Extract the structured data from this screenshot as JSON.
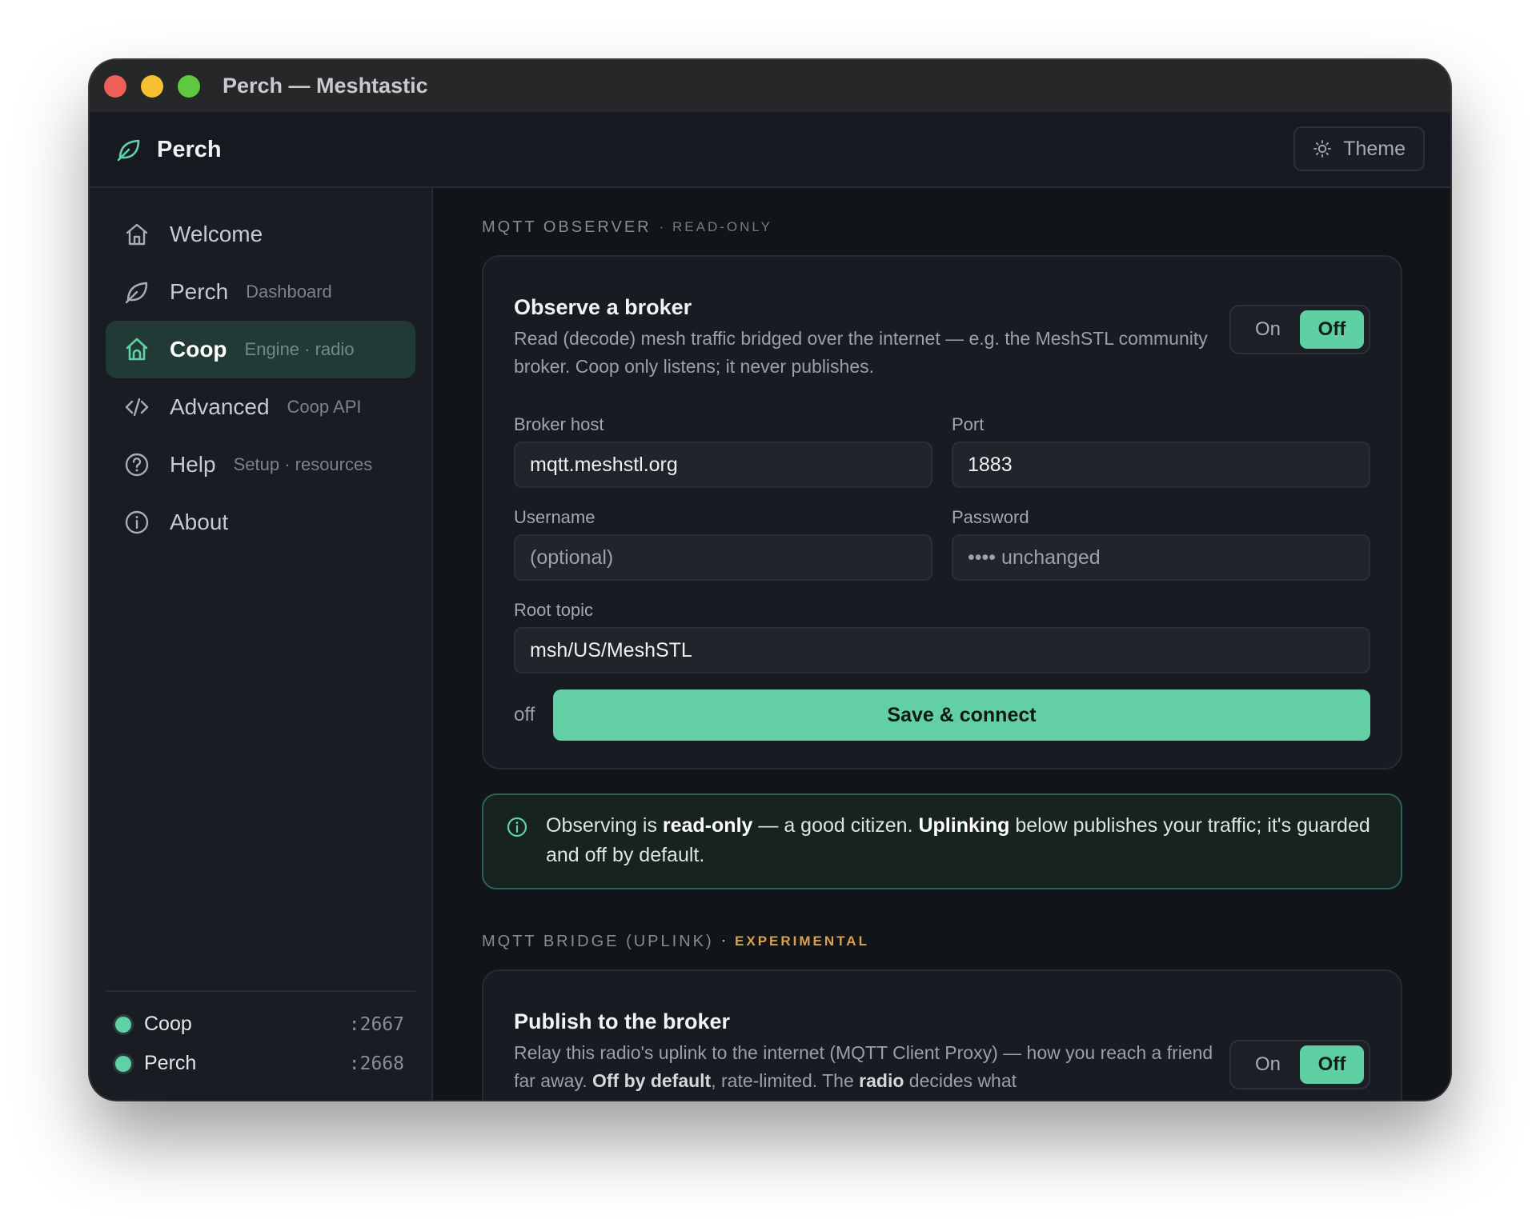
{
  "window": {
    "title": "Perch — Meshtastic"
  },
  "header": {
    "brand": "Perch",
    "theme_label": "Theme"
  },
  "sidebar": {
    "items": [
      {
        "label": "Welcome",
        "sub": ""
      },
      {
        "label": "Perch",
        "sub": "Dashboard"
      },
      {
        "label": "Coop",
        "sub": "Engine · radio"
      },
      {
        "label": "Advanced",
        "sub": "Coop API"
      },
      {
        "label": "Help",
        "sub": "Setup · resources"
      },
      {
        "label": "About",
        "sub": ""
      }
    ],
    "active_item": "Coop",
    "services": [
      {
        "name": "Coop",
        "port": ":2667",
        "status_color": "#5ed1a6"
      },
      {
        "name": "Perch",
        "port": ":2668",
        "status_color": "#5ed1a6"
      }
    ]
  },
  "observer": {
    "section_label": "MQTT OBSERVER",
    "section_tag": "· READ-ONLY",
    "title": "Observe a broker",
    "description": "Read (decode) mesh traffic bridged over the internet — e.g. the MeshSTL community broker. Coop only listens; it never publishes.",
    "toggle": {
      "on_label": "On",
      "off_label": "Off",
      "selected": "Off"
    },
    "fields": {
      "host_label": "Broker host",
      "host_value": "mqtt.meshstl.org",
      "port_label": "Port",
      "port_value": "1883",
      "username_label": "Username",
      "username_placeholder": "(optional)",
      "password_label": "Password",
      "password_placeholder": "•••• unchanged",
      "root_label": "Root topic",
      "root_value": "msh/US/MeshSTL"
    },
    "connection_state": "off",
    "save_label": "Save & connect"
  },
  "info": {
    "t1": "Observing is ",
    "b1": "read-only",
    "t2": " — a good citizen. ",
    "b2": "Uplinking",
    "t3": " below publishes your traffic; it's guarded and off by default."
  },
  "bridge": {
    "section_label": "MQTT BRIDGE (UPLINK)",
    "section_tag": "· EXPERIMENTAL",
    "title": "Publish to the broker",
    "d1": "Relay this radio's uplink to the internet (MQTT Client Proxy) — how you reach a friend far away. ",
    "b1": "Off by default",
    "d2": ", rate-limited. The ",
    "b2": "radio",
    "d3": " decides what",
    "toggle": {
      "on_label": "On",
      "off_label": "Off",
      "selected": "Off"
    }
  },
  "colors": {
    "accent": "#62cfa5",
    "warning": "#d9a24b",
    "background": "#111419"
  }
}
